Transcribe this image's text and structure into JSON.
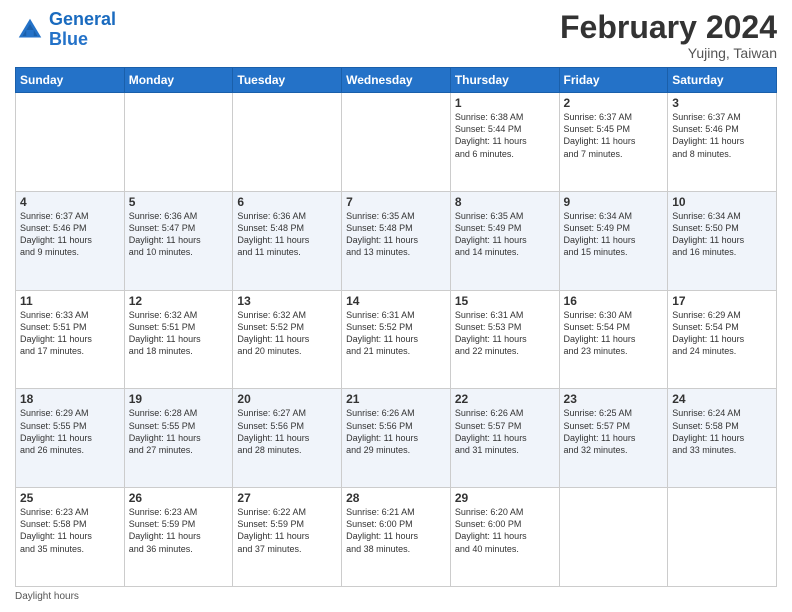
{
  "header": {
    "logo_line1": "General",
    "logo_line2": "Blue",
    "month_title": "February 2024",
    "location": "Yujing, Taiwan"
  },
  "weekdays": [
    "Sunday",
    "Monday",
    "Tuesday",
    "Wednesday",
    "Thursday",
    "Friday",
    "Saturday"
  ],
  "weeks": [
    [
      {
        "day": "",
        "info": ""
      },
      {
        "day": "",
        "info": ""
      },
      {
        "day": "",
        "info": ""
      },
      {
        "day": "",
        "info": ""
      },
      {
        "day": "1",
        "info": "Sunrise: 6:38 AM\nSunset: 5:44 PM\nDaylight: 11 hours\nand 6 minutes."
      },
      {
        "day": "2",
        "info": "Sunrise: 6:37 AM\nSunset: 5:45 PM\nDaylight: 11 hours\nand 7 minutes."
      },
      {
        "day": "3",
        "info": "Sunrise: 6:37 AM\nSunset: 5:46 PM\nDaylight: 11 hours\nand 8 minutes."
      }
    ],
    [
      {
        "day": "4",
        "info": "Sunrise: 6:37 AM\nSunset: 5:46 PM\nDaylight: 11 hours\nand 9 minutes."
      },
      {
        "day": "5",
        "info": "Sunrise: 6:36 AM\nSunset: 5:47 PM\nDaylight: 11 hours\nand 10 minutes."
      },
      {
        "day": "6",
        "info": "Sunrise: 6:36 AM\nSunset: 5:48 PM\nDaylight: 11 hours\nand 11 minutes."
      },
      {
        "day": "7",
        "info": "Sunrise: 6:35 AM\nSunset: 5:48 PM\nDaylight: 11 hours\nand 13 minutes."
      },
      {
        "day": "8",
        "info": "Sunrise: 6:35 AM\nSunset: 5:49 PM\nDaylight: 11 hours\nand 14 minutes."
      },
      {
        "day": "9",
        "info": "Sunrise: 6:34 AM\nSunset: 5:49 PM\nDaylight: 11 hours\nand 15 minutes."
      },
      {
        "day": "10",
        "info": "Sunrise: 6:34 AM\nSunset: 5:50 PM\nDaylight: 11 hours\nand 16 minutes."
      }
    ],
    [
      {
        "day": "11",
        "info": "Sunrise: 6:33 AM\nSunset: 5:51 PM\nDaylight: 11 hours\nand 17 minutes."
      },
      {
        "day": "12",
        "info": "Sunrise: 6:32 AM\nSunset: 5:51 PM\nDaylight: 11 hours\nand 18 minutes."
      },
      {
        "day": "13",
        "info": "Sunrise: 6:32 AM\nSunset: 5:52 PM\nDaylight: 11 hours\nand 20 minutes."
      },
      {
        "day": "14",
        "info": "Sunrise: 6:31 AM\nSunset: 5:52 PM\nDaylight: 11 hours\nand 21 minutes."
      },
      {
        "day": "15",
        "info": "Sunrise: 6:31 AM\nSunset: 5:53 PM\nDaylight: 11 hours\nand 22 minutes."
      },
      {
        "day": "16",
        "info": "Sunrise: 6:30 AM\nSunset: 5:54 PM\nDaylight: 11 hours\nand 23 minutes."
      },
      {
        "day": "17",
        "info": "Sunrise: 6:29 AM\nSunset: 5:54 PM\nDaylight: 11 hours\nand 24 minutes."
      }
    ],
    [
      {
        "day": "18",
        "info": "Sunrise: 6:29 AM\nSunset: 5:55 PM\nDaylight: 11 hours\nand 26 minutes."
      },
      {
        "day": "19",
        "info": "Sunrise: 6:28 AM\nSunset: 5:55 PM\nDaylight: 11 hours\nand 27 minutes."
      },
      {
        "day": "20",
        "info": "Sunrise: 6:27 AM\nSunset: 5:56 PM\nDaylight: 11 hours\nand 28 minutes."
      },
      {
        "day": "21",
        "info": "Sunrise: 6:26 AM\nSunset: 5:56 PM\nDaylight: 11 hours\nand 29 minutes."
      },
      {
        "day": "22",
        "info": "Sunrise: 6:26 AM\nSunset: 5:57 PM\nDaylight: 11 hours\nand 31 minutes."
      },
      {
        "day": "23",
        "info": "Sunrise: 6:25 AM\nSunset: 5:57 PM\nDaylight: 11 hours\nand 32 minutes."
      },
      {
        "day": "24",
        "info": "Sunrise: 6:24 AM\nSunset: 5:58 PM\nDaylight: 11 hours\nand 33 minutes."
      }
    ],
    [
      {
        "day": "25",
        "info": "Sunrise: 6:23 AM\nSunset: 5:58 PM\nDaylight: 11 hours\nand 35 minutes."
      },
      {
        "day": "26",
        "info": "Sunrise: 6:23 AM\nSunset: 5:59 PM\nDaylight: 11 hours\nand 36 minutes."
      },
      {
        "day": "27",
        "info": "Sunrise: 6:22 AM\nSunset: 5:59 PM\nDaylight: 11 hours\nand 37 minutes."
      },
      {
        "day": "28",
        "info": "Sunrise: 6:21 AM\nSunset: 6:00 PM\nDaylight: 11 hours\nand 38 minutes."
      },
      {
        "day": "29",
        "info": "Sunrise: 6:20 AM\nSunset: 6:00 PM\nDaylight: 11 hours\nand 40 minutes."
      },
      {
        "day": "",
        "info": ""
      },
      {
        "day": "",
        "info": ""
      }
    ]
  ],
  "footer": {
    "note": "Daylight hours"
  }
}
